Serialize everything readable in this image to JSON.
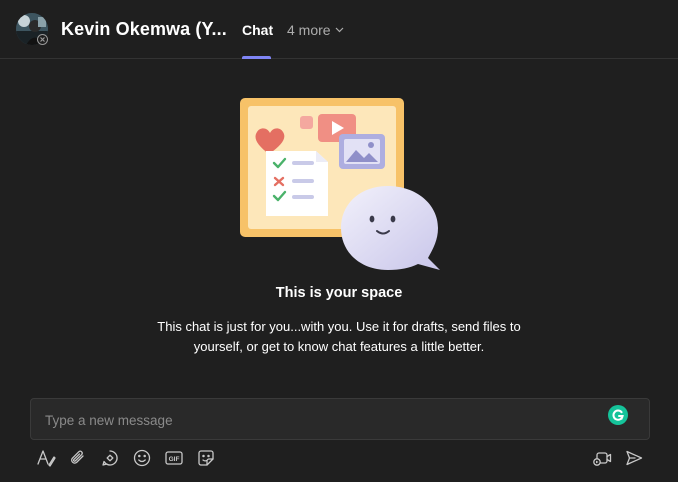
{
  "header": {
    "user_name": "Kevin Okemwa (Y...",
    "tabs": [
      {
        "label": "Chat",
        "active": true
      },
      {
        "label": "4 more",
        "active": false
      }
    ],
    "accent_color": "#7f85f5"
  },
  "main": {
    "title": "This is your space",
    "description_lines": [
      "This chat is just for you...with you. Use it for drafts, send files to",
      "yourself, or get to know chat features a little better."
    ]
  },
  "compose": {
    "placeholder": "Type a new message",
    "value": ""
  },
  "toolbar": {
    "icons": [
      "format-icon",
      "attach-icon",
      "loop-icon",
      "emoji-icon",
      "gif-icon",
      "sticker-icon",
      "video-clip-icon",
      "send-icon"
    ],
    "gif_label": "GIF"
  },
  "colors": {
    "background": "#1f1f1f",
    "compose_background": "#292929",
    "grammarly": "#15c39a"
  }
}
